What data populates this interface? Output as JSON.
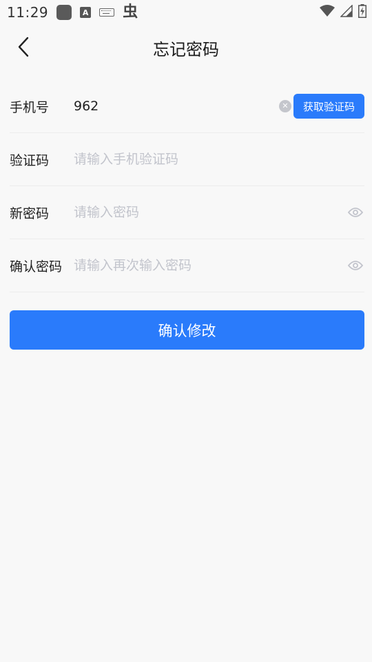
{
  "status_bar": {
    "time": "11:29",
    "icons": [
      "app-square-icon",
      "text-a-icon",
      "keyboard-icon",
      "bug-icon",
      "wifi-icon",
      "signal-icon",
      "battery-icon"
    ],
    "a_glyph": "A",
    "bug_glyph": "虫"
  },
  "nav": {
    "title": "忘记密码",
    "back_icon": "chevron-left-icon"
  },
  "form": {
    "phone": {
      "label": "手机号",
      "value": "962",
      "clear_icon": "clear-icon",
      "code_button": "获取验证码"
    },
    "code": {
      "label": "验证码",
      "placeholder": "请输入手机验证码"
    },
    "new_password": {
      "label": "新密码",
      "placeholder": "请输入密码",
      "toggle_icon": "eye-icon"
    },
    "confirm_password": {
      "label": "确认密码",
      "placeholder": "请输入再次输入密码",
      "toggle_icon": "eye-icon"
    }
  },
  "submit_label": "确认修改",
  "colors": {
    "accent": "#2a7bfb",
    "background": "#f8f8f8",
    "placeholder": "#c2c4cc",
    "divider": "#ececec"
  }
}
